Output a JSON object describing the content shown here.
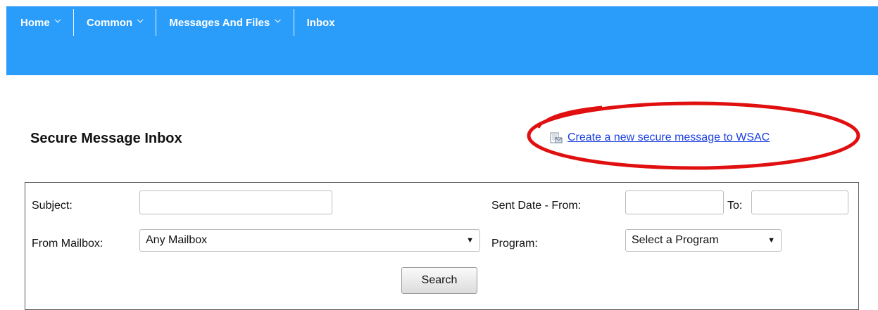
{
  "nav": {
    "items": [
      {
        "label": "Home",
        "has_dropdown": true
      },
      {
        "label": "Common",
        "has_dropdown": true
      },
      {
        "label": "Messages And Files",
        "has_dropdown": true
      },
      {
        "label": "Inbox",
        "has_dropdown": false
      }
    ]
  },
  "page": {
    "title": "Secure Message Inbox",
    "create_link": "Create a new secure message to WSAC"
  },
  "search_form": {
    "subject_label": "Subject:",
    "subject_value": "",
    "sent_from_label": "Sent Date - From:",
    "sent_from_value": "",
    "to_label": "To:",
    "to_value": "",
    "from_mailbox_label": "From Mailbox:",
    "from_mailbox_value": "Any Mailbox",
    "program_label": "Program:",
    "program_value": "Select a Program",
    "search_button": "Search"
  },
  "colors": {
    "nav_bg": "#2a9dfb",
    "link": "#1a3fe0",
    "annotation": "#e01010"
  }
}
